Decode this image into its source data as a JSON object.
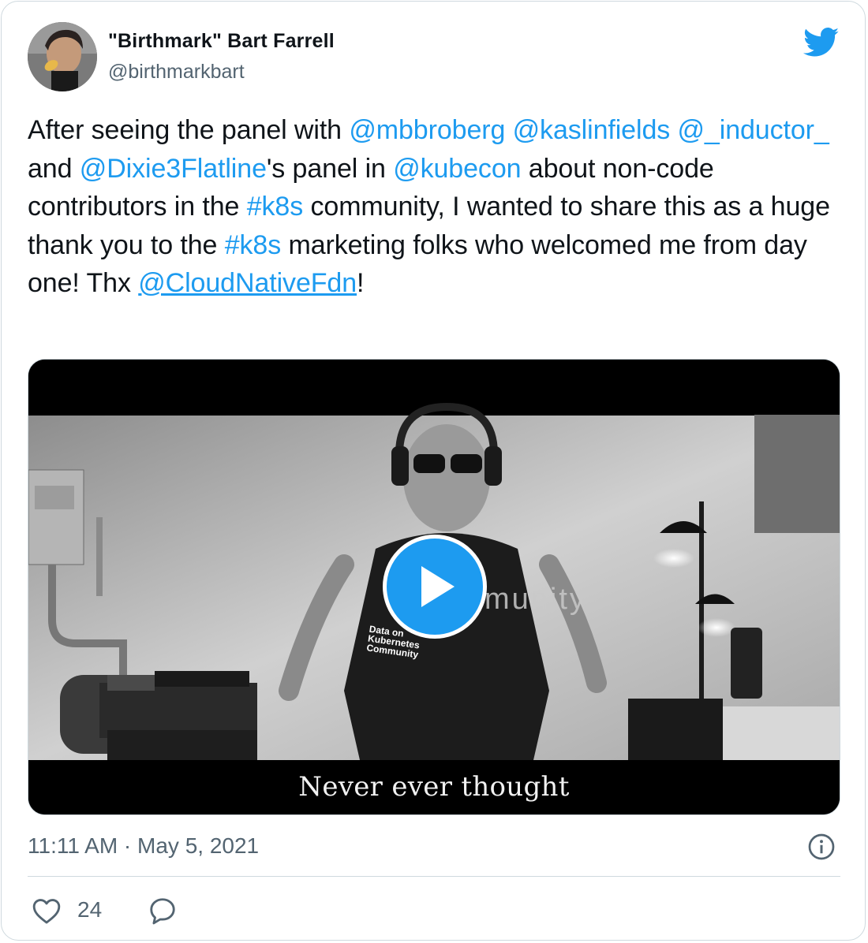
{
  "author": {
    "name": "\"Birthmark\" Bart Farrell",
    "handle": "@birthmarkbart"
  },
  "tweet": {
    "segments": [
      {
        "text": "After seeing the panel with ",
        "type": "text"
      },
      {
        "text": "@mbbroberg",
        "type": "mention"
      },
      {
        "text": " ",
        "type": "text"
      },
      {
        "text": "@kaslinfields",
        "type": "mention"
      },
      {
        "text": " ",
        "type": "text"
      },
      {
        "text": "@_inductor_",
        "type": "mention"
      },
      {
        "text": " and ",
        "type": "text"
      },
      {
        "text": "@Dixie3Flatline",
        "type": "mention"
      },
      {
        "text": "'s panel in ",
        "type": "text"
      },
      {
        "text": "@kubecon",
        "type": "mention"
      },
      {
        "text": " about non-code contributors in the ",
        "type": "text"
      },
      {
        "text": "#k8s",
        "type": "tag"
      },
      {
        "text": " community, I wanted to share this as a huge thank you to the ",
        "type": "text"
      },
      {
        "text": "#k8s",
        "type": "tag"
      },
      {
        "text": " marketing folks who welcomed me from day one! Thx ",
        "type": "text"
      },
      {
        "text": "@CloudNativeFdn",
        "type": "mention-underlined"
      },
      {
        "text": "!",
        "type": "text"
      }
    ]
  },
  "media": {
    "caption": "Never ever thought",
    "shirt_lines": [
      "Data on",
      "Kubernetes",
      "Community"
    ],
    "wall_text": "munity"
  },
  "meta": {
    "timestamp": "11:11 AM · May 5, 2021"
  },
  "actions": {
    "like_count": "24"
  },
  "icons": {
    "brand": "twitter-bird-icon",
    "play": "play-icon",
    "info": "info-icon",
    "like": "heart-icon",
    "reply": "reply-bubble-icon"
  },
  "colors": {
    "accent": "#1d9bf0",
    "secondary_text": "#536471",
    "border": "#cfd9de"
  }
}
